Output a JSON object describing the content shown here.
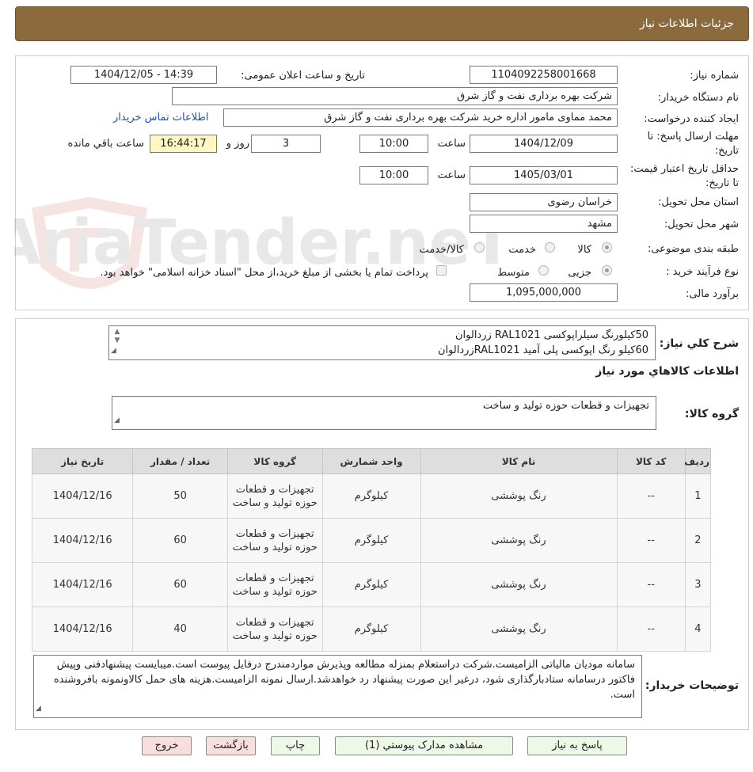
{
  "header": {
    "title": "جزئیات اطلاعات نیاز"
  },
  "info": {
    "need_number_label": "شماره نیاز:",
    "need_number": "1104092258001668",
    "announce_label": "تاریخ و ساعت اعلان عمومی:",
    "announce_value": "1404/12/05 - 14:39",
    "buyer_label": "نام دستگاه خریدار:",
    "buyer_value": "شرکت بهره برداری نفت و گاز شرق",
    "creator_label": "ایجاد کننده درخواست:",
    "creator_value": "محمد مماوی مامور اداره خرید شرکت بهره برداری نفت و گاز شرق",
    "contact_link": "اطلاعات تماس خریدار",
    "deadline_label": "مهلت ارسال پاسخ: تا تاریخ:",
    "deadline_date": "1404/12/09",
    "time_label": "ساعت",
    "deadline_time": "10:00",
    "days_value": "3",
    "days_label": "روز و",
    "remaining_time": "16:44:17",
    "remaining_label": "ساعت باقي مانده",
    "validity_label": "حداقل تاریخ اعتبار قیمت: تا تاریخ:",
    "validity_date": "1405/03/01",
    "validity_time": "10:00",
    "province_label": "استان محل تحویل:",
    "province_value": "خراسان رضوی",
    "city_label": "شهر محل تحویل:",
    "city_value": "مشهد",
    "category_label": "طبقه بندی موضوعی:",
    "category_options": [
      "کالا",
      "خدمت",
      "کالا/خدمت"
    ],
    "process_label": "نوع فرآیند خرید :",
    "process_options": [
      "جزیی",
      "متوسط"
    ],
    "payment_note": "پرداخت تمام یا بخشی از مبلغ خرید،از محل \"اسناد خزانه اسلامی\" خواهد بود.",
    "budget_label": "برآورد مالی:",
    "budget_value": "1,095,000,000"
  },
  "summary": {
    "label": "شرح کلي نياز:",
    "line1": "50کیلورنگ سیلراپوکسی RAL1021 زردالوان",
    "line2": "60کیلو رنگ اپوکسی پلی آمید RAL1021زردالوان"
  },
  "goods": {
    "section_title": "اطلاعات کالاهاي مورد نياز",
    "group_label": "گروه کالا:",
    "group_value": "تجهیزات و قطعات حوزه تولید و ساخت"
  },
  "table": {
    "headers": [
      "رديف",
      "کد کالا",
      "نام کالا",
      "واحد شمارش",
      "گروه کالا",
      "تعداد / مقدار",
      "تاریخ نیاز"
    ],
    "rows": [
      [
        "1",
        "--",
        "رنگ پوششی",
        "کیلوگرم",
        "تجهیزات و قطعات حوزه تولید و ساخت",
        "50",
        "1404/12/16"
      ],
      [
        "2",
        "--",
        "رنگ پوششی",
        "کیلوگرم",
        "تجهیزات و قطعات حوزه تولید و ساخت",
        "60",
        "1404/12/16"
      ],
      [
        "3",
        "--",
        "رنگ پوششی",
        "کیلوگرم",
        "تجهیزات و قطعات حوزه تولید و ساخت",
        "60",
        "1404/12/16"
      ],
      [
        "4",
        "--",
        "رنگ پوششی",
        "کیلوگرم",
        "تجهیزات و قطعات حوزه تولید و ساخت",
        "40",
        "1404/12/16"
      ]
    ]
  },
  "buyer_notes": {
    "label": "توضیحات خریدار:",
    "text": "سامانه مودیان مالیاتی الزامیست.شرکت دراستعلام بمنزله مطالعه وپذیرش مواردمندرج درفایل پیوست است.میبایست پیشنهادفنی وپیش فاکتور درسامانه ستادبارگذاری شود، درغیر این صورت پیشنهاد رد خواهدشد.ارسال نمونه الزامیست.هزینه های حمل کالاونمونه بافروشنده است."
  },
  "buttons": {
    "reply": "پاسخ به نیاز",
    "attachments": "مشاهده مدارک پیوستي (1)",
    "print": "چاپ",
    "back": "بازگشت",
    "exit": "خروج"
  },
  "watermark": {
    "text": "AriaTender.neT"
  },
  "colors": {
    "header_bg": "#8b6a3e",
    "link": "#1a4fd1",
    "remaining_bg": "#fff7c2",
    "green_button": "#eef8e6",
    "pink_button": "#f9dede"
  }
}
